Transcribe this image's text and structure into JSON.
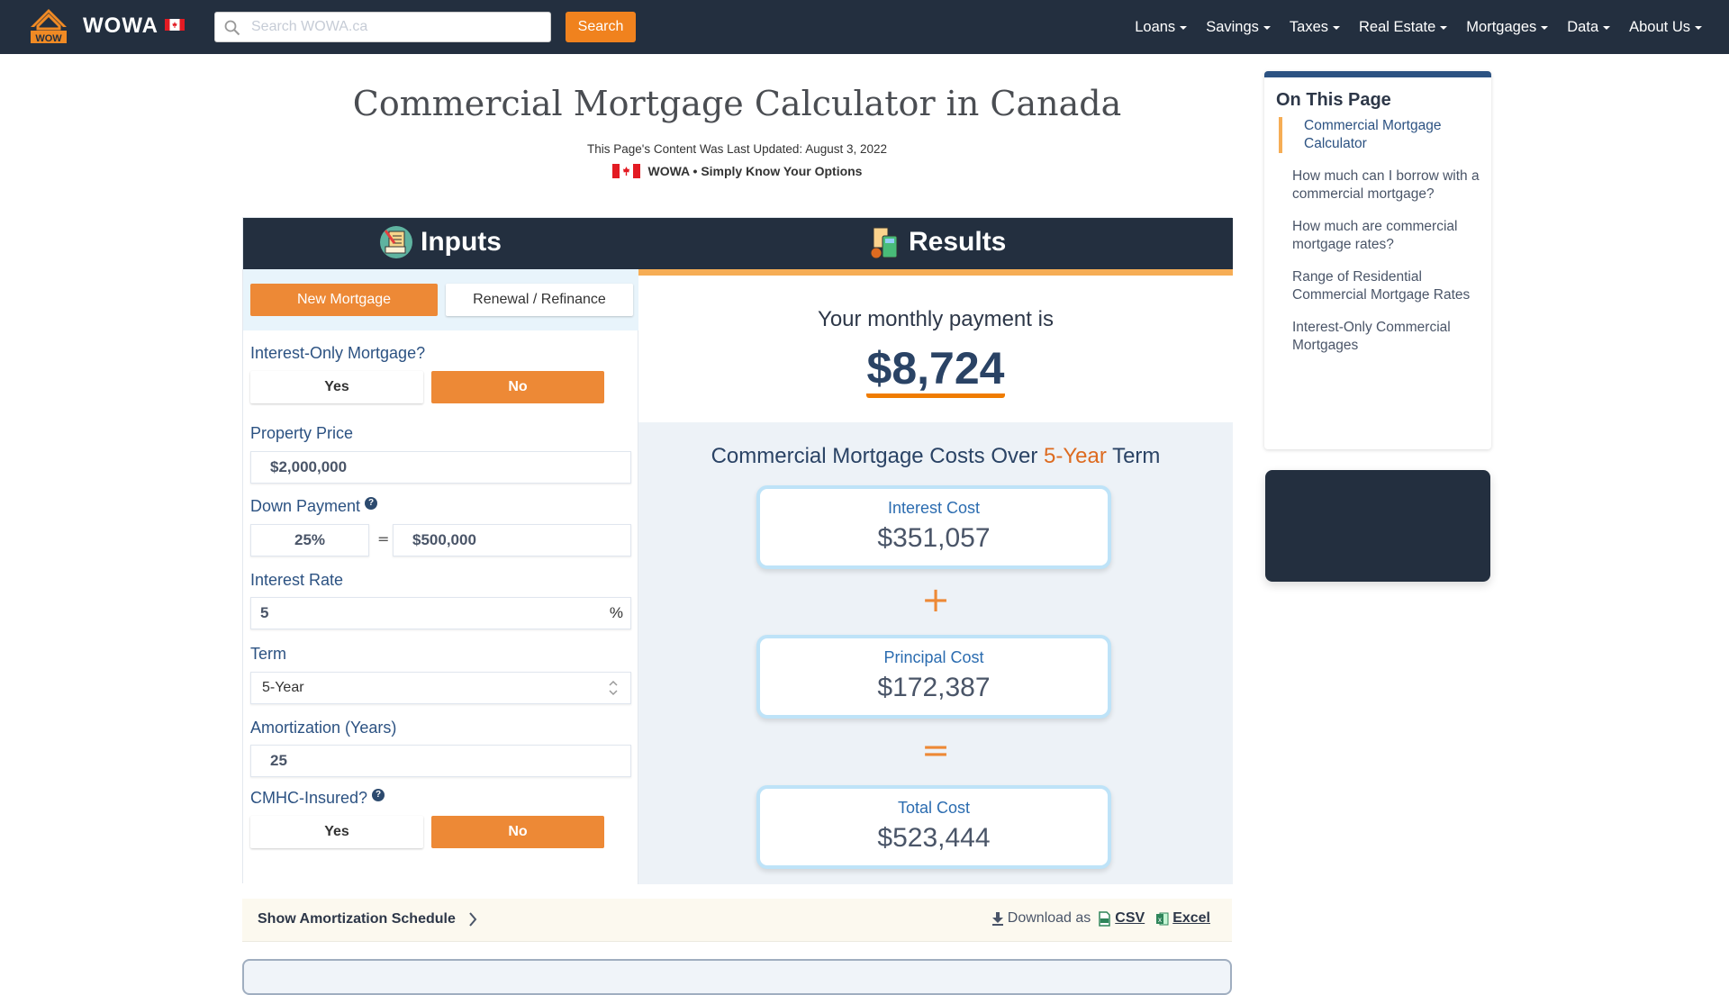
{
  "nav": {
    "brand": "WOWA",
    "search_placeholder": "Search WOWA.ca",
    "search_value": "",
    "search_button": "Search",
    "menu": [
      "Loans",
      "Savings",
      "Taxes",
      "Real Estate",
      "Mortgages",
      "Data",
      "About Us"
    ]
  },
  "header": {
    "title": "Commercial Mortgage Calculator in Canada",
    "updated": "This Page's Content Was Last Updated: August 3, 2022",
    "tagline": "WOWA • Simply Know Your Options"
  },
  "calculator": {
    "inputs_title": "Inputs",
    "results_title": "Results",
    "mode": {
      "options": [
        "New Mortgage",
        "Renewal / Refinance"
      ],
      "selected": "New Mortgage"
    },
    "interest_only": {
      "label": "Interest-Only Mortgage?",
      "yes": "Yes",
      "no": "No",
      "selected": "No"
    },
    "property_price": {
      "label": "Property Price",
      "value": "$2,000,000"
    },
    "down_payment": {
      "label": "Down Payment",
      "percent": "25%",
      "equals": "=",
      "amount": "$500,000"
    },
    "interest_rate": {
      "label": "Interest Rate",
      "value": "5",
      "suffix": "%"
    },
    "term": {
      "label": "Term",
      "value": "5-Year"
    },
    "amortization": {
      "label": "Amortization (Years)",
      "value": "25"
    },
    "cmhc": {
      "label": "CMHC-Insured?",
      "yes": "Yes",
      "no": "No",
      "selected": "No"
    }
  },
  "results": {
    "monthly_label": "Your monthly payment is",
    "monthly_value": "$8,724",
    "costs_title_prefix": "Commercial Mortgage Costs Over ",
    "costs_title_highlight": "5-Year",
    "costs_title_suffix": " Term",
    "interest": {
      "label": "Interest Cost",
      "value": "$351,057"
    },
    "plus": "+",
    "principal": {
      "label": "Principal Cost",
      "value": "$172,387"
    },
    "equals": "=",
    "total": {
      "label": "Total Cost",
      "value": "$523,444"
    }
  },
  "amortization_bar": {
    "toggle": "Show Amortization Schedule",
    "download_label": "Download as",
    "csv": "CSV",
    "excel": "Excel"
  },
  "toc": {
    "title": "On This Page",
    "items": [
      "Commercial Mortgage Calculator",
      "How much can I borrow with a commercial mortgage?",
      "How much are commercial mortgage rates?",
      "Range of Residential Commercial Mortgage Rates",
      "Interest-Only Commercial Mortgages"
    ],
    "active_index": 0
  },
  "colors": {
    "navbar": "#232f3f",
    "accent_orange": "#ed8936",
    "link_blue": "#2c5282"
  }
}
